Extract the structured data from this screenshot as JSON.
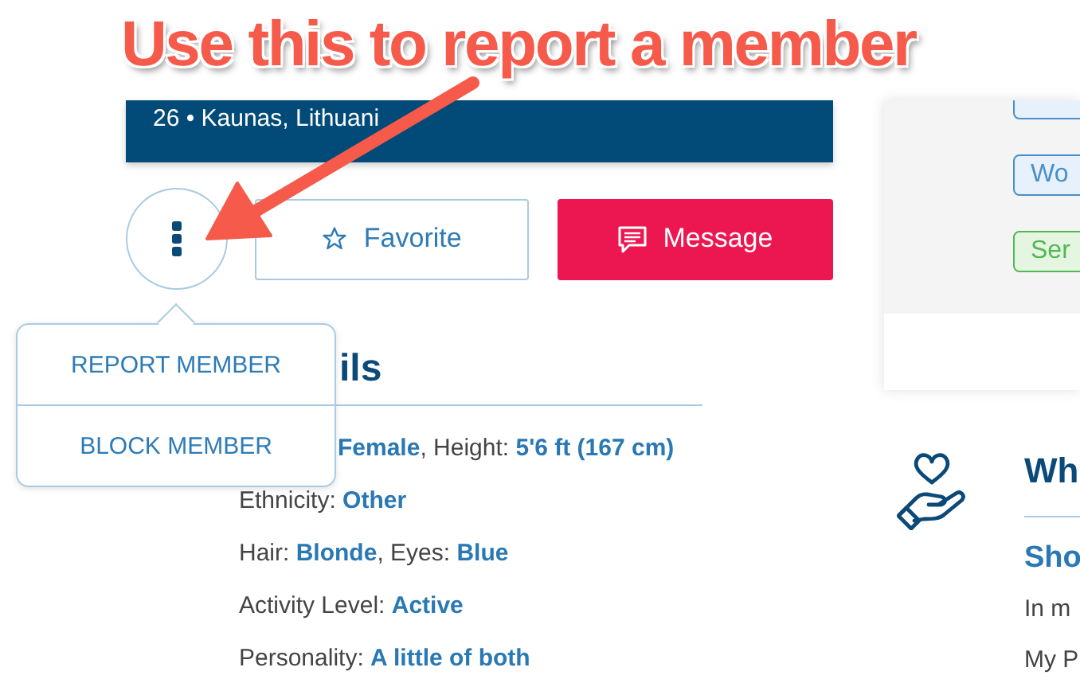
{
  "annotation": {
    "text": "Use this to report a member"
  },
  "profile": {
    "location": "26 • Kaunas, Lithuani"
  },
  "actions": {
    "favorite": "Favorite",
    "message": "Message"
  },
  "menu": {
    "items": [
      {
        "label": "REPORT MEMBER"
      },
      {
        "label": "BLOCK MEMBER"
      }
    ]
  },
  "details": {
    "heading": "ils",
    "lines": [
      "**Female**, Height: **5'6 ft (167 cm)**",
      "Ethnicity: **Other**",
      "Hair: **Blonde**, Eyes: **Blue**",
      "Activity Level: **Active**",
      "Personality: **A little of both**"
    ]
  },
  "tags": [
    {
      "color": "#4a8fc9"
    },
    {
      "label": "Wo",
      "color": "#4a8fc9"
    },
    {
      "label": "Ser",
      "color": "#55b655"
    }
  ],
  "wish": {
    "heading": "Wh",
    "subheading": "Sho",
    "lines": [
      "In m",
      "My P"
    ]
  }
}
